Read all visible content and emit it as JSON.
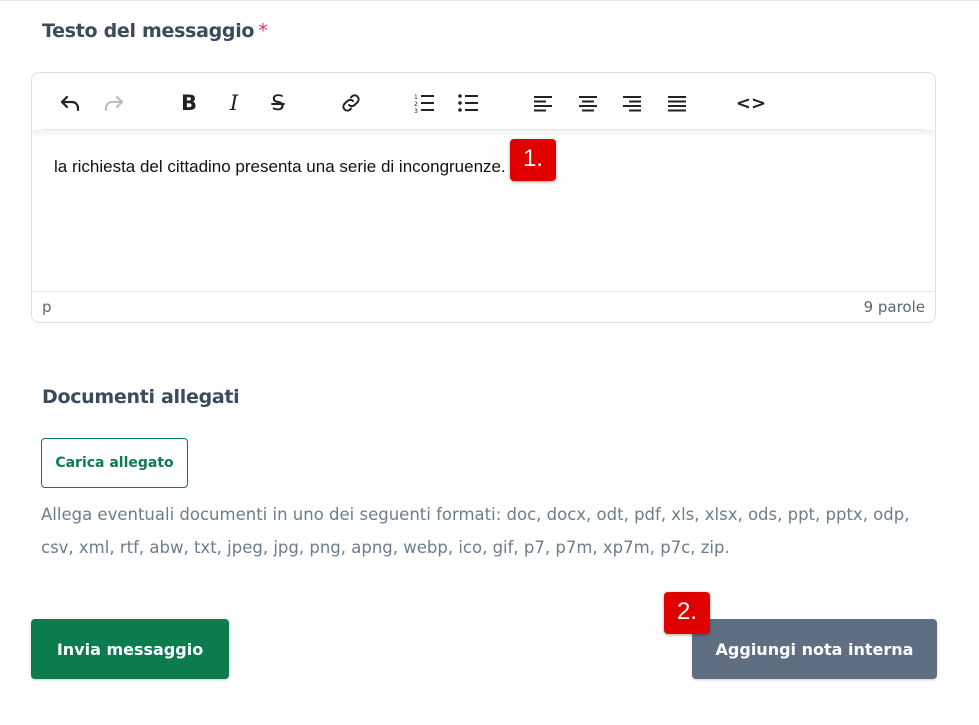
{
  "message": {
    "label": "Testo del messaggio",
    "required_mark": "*"
  },
  "editor": {
    "toolbar": [
      {
        "name": "undo",
        "icon": "undo-icon"
      },
      {
        "name": "redo",
        "icon": "redo-icon"
      },
      {
        "name": "bold",
        "icon": "bold-icon",
        "glyph": "B"
      },
      {
        "name": "italic",
        "icon": "italic-icon",
        "glyph": "I"
      },
      {
        "name": "strikethrough",
        "icon": "strikethrough-icon",
        "glyph": "S"
      },
      {
        "name": "link",
        "icon": "link-icon"
      },
      {
        "name": "numbered-list",
        "icon": "numbered-list-icon"
      },
      {
        "name": "bullet-list",
        "icon": "bullet-list-icon"
      },
      {
        "name": "align-left",
        "icon": "align-left-icon"
      },
      {
        "name": "align-center",
        "icon": "align-center-icon"
      },
      {
        "name": "align-right",
        "icon": "align-right-icon"
      },
      {
        "name": "justify",
        "icon": "justify-icon"
      },
      {
        "name": "source-code",
        "icon": "code-icon",
        "glyph": "<>"
      }
    ],
    "content": "la richiesta del cittadino presenta una serie di incongruenze.",
    "status_path": "p",
    "word_count": "9 parole"
  },
  "annotations": {
    "badge1": "1.",
    "badge2": "2."
  },
  "attachments": {
    "title": "Documenti allegati",
    "upload_label": "Carica allegato",
    "formats_text": "Allega eventuali documenti in uno dei seguenti formati: doc, docx, odt, pdf, xls, xlsx, ods, ppt, pptx, odp, csv, xml, rtf, abw, txt, jpeg, jpg, png, apng, webp, ico, gif, p7, p7m, xp7m, p7c, zip."
  },
  "actions": {
    "send_label": "Invia messaggio",
    "internal_note_label": "Aggiungi nota interna"
  },
  "colors": {
    "primary": "#0c7b4e",
    "secondary": "#5f6f82",
    "required": "#d9364f",
    "badge": "#e00000"
  }
}
